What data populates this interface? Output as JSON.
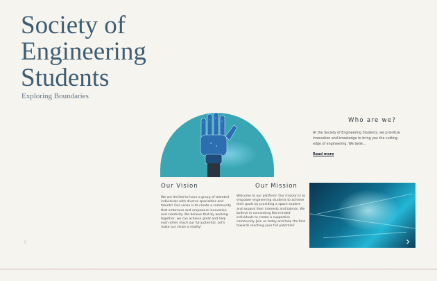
{
  "header": {
    "title": "Society of Engineering Students",
    "tagline": "Exploring Boundaries"
  },
  "about": {
    "heading": "Who are we?",
    "body": "At the Society of Engineering Students, we prioritize innovation and knowledge to bring you the cutting-edge of engineering. We belie...",
    "read_more": "Read more"
  },
  "vision": {
    "heading": "Our Vision",
    "body": "We are thrilled to have a group of talented individuals with diverse specialties and talents! Our vision is to create a community that embraces and empowers innovation and creativity. We believe that by working together, we can achieve great and help each other reach our full potential. Let's make our vision a reality!"
  },
  "mission": {
    "heading": "Our Mission",
    "body": "Welcome to our platform! Our mission is to empower engineering students to achieve their goals by providing a space explore and expand their interests and talents. We believe in connecting like-minded individuals to create a supportive community. Join us today and take the first towards reaching your full potential!"
  },
  "slider": {
    "prev": "‹",
    "next": "›"
  },
  "images": {
    "hero": "robot-hand-illustration",
    "tech": "tech-abstract-photo"
  },
  "colors": {
    "title": "#3e5d73",
    "arch": "#3aa6b4",
    "background": "#f6f4ef"
  }
}
